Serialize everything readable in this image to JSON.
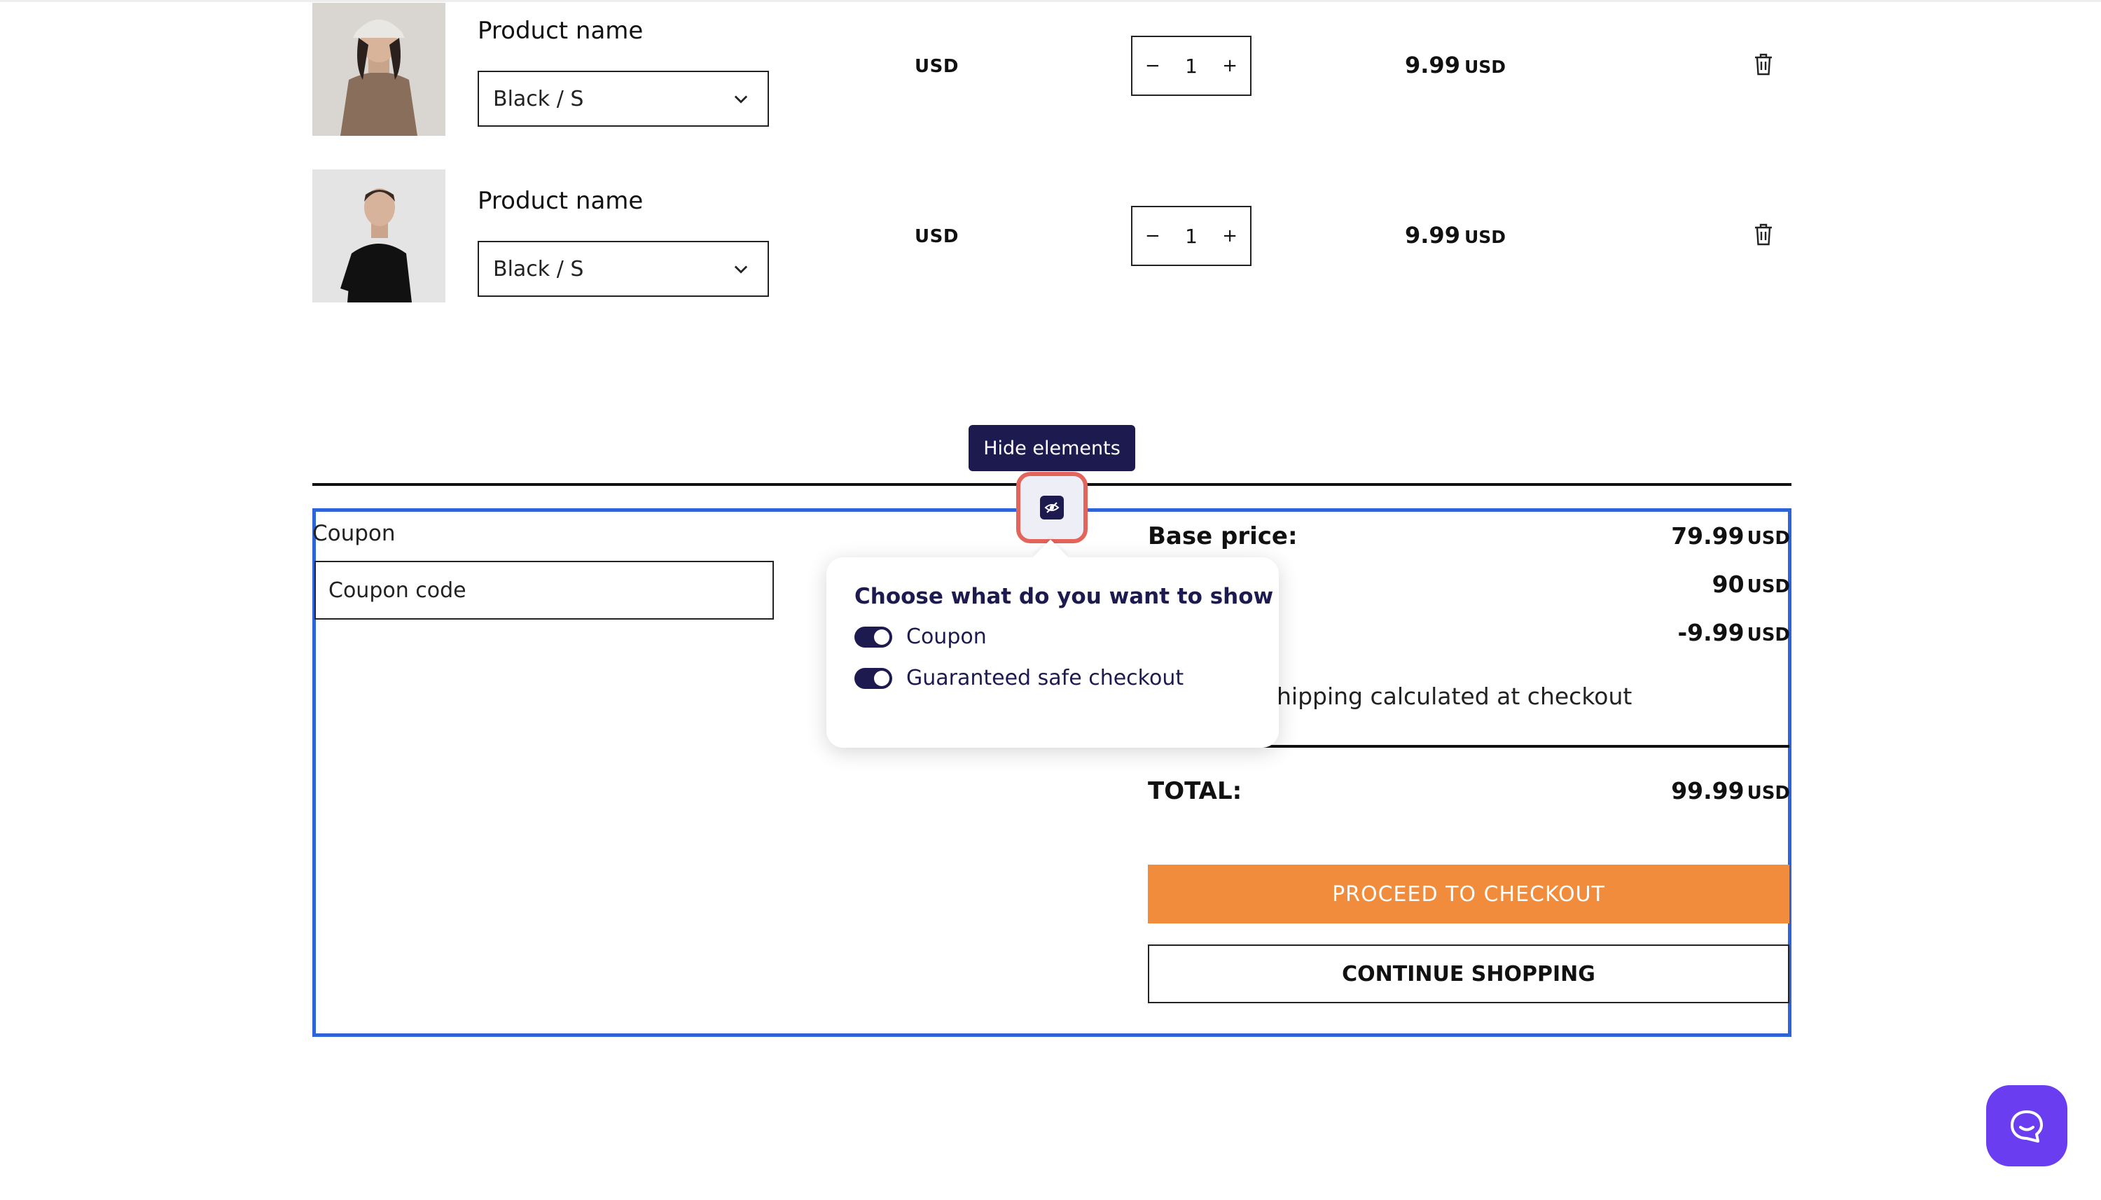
{
  "cart": {
    "items": [
      {
        "name": "Product name",
        "variant": "Black / S",
        "currency": "USD",
        "quantity": "1",
        "price": "9.99",
        "price_currency": "USD",
        "image_colors": {
          "bg": "#d9d6d2",
          "garment": "#8a6e5c",
          "hat": "#e9e7e3"
        }
      },
      {
        "name": "Product name",
        "variant": "Black / S",
        "currency": "USD",
        "quantity": "1",
        "price": "9.99",
        "price_currency": "USD",
        "image_colors": {
          "bg": "#e4e4e4",
          "garment": "#111111"
        }
      }
    ],
    "qty_minus": "−",
    "qty_plus": "+"
  },
  "toolbar": {
    "tooltip": "Hide elements",
    "toggle_icon": "eye-slash-icon"
  },
  "coupon": {
    "label": "Coupon",
    "placeholder": "Coupon code"
  },
  "popup": {
    "title": "Choose what do you want to show",
    "options": [
      {
        "label": "Coupon",
        "enabled": true
      },
      {
        "label": "Guaranteed safe checkout",
        "enabled": true
      }
    ]
  },
  "summary": {
    "base_label": "Base price:",
    "base_value": "79.99",
    "row2_value": "90",
    "row3_value": "-9.99",
    "currency": "USD",
    "shipping_note": "hipping calculated at checkout",
    "total_label": "TOTAL:",
    "total_value": "99.99",
    "checkout_label": "PROCEED TO CHECKOUT",
    "continue_label": "CONTINUE SHOPPING"
  },
  "colors": {
    "accent_orange": "#f08c3c",
    "selection_blue": "#2f63d9",
    "navy": "#1d1a50",
    "chat_purple": "#6a3df0",
    "highlight_red": "#e3645b"
  }
}
